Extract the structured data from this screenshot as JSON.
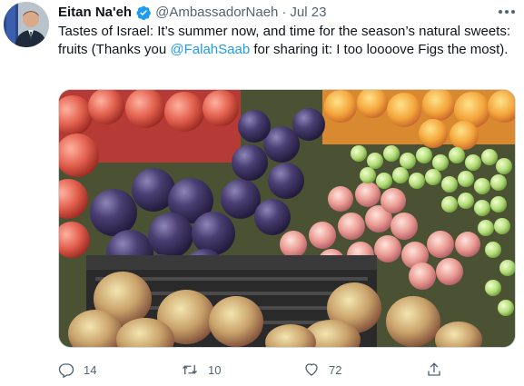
{
  "tweet": {
    "author": {
      "display_name": "Eitan Na'eh",
      "handle": "@AmbassadorNaeh",
      "separator": "·",
      "date": "Jul 23",
      "verified": true,
      "avatar_icon": "profile-photo"
    },
    "text": {
      "part1": "Tastes of Israel: It’s summer now, and time for the season’s natural sweets:  fruits (Thanks you ",
      "mention": "@FalahSaab",
      "part2": " for sharing it: I too loooove Figs the most)."
    },
    "media": {
      "description_icon": "fruit-photo"
    },
    "actions": {
      "reply_count": "14",
      "retweet_count": "10",
      "like_count": "72"
    }
  },
  "colors": {
    "accent": "#1d9bf0",
    "text_primary": "#0f1419",
    "text_secondary": "#536471"
  }
}
